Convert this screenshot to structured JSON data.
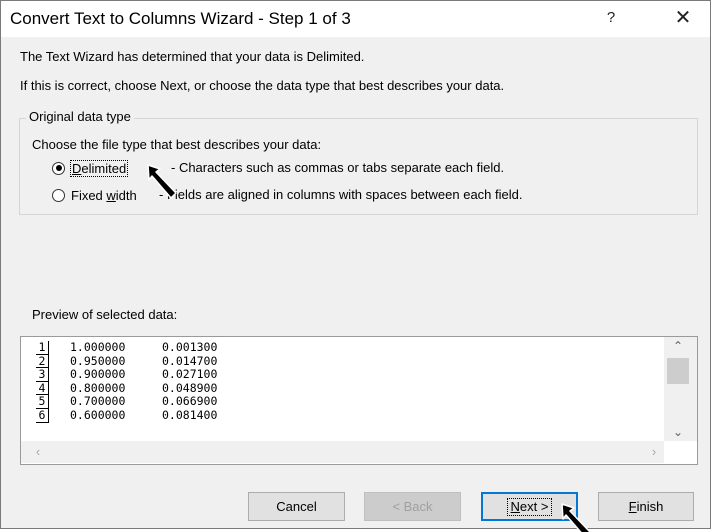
{
  "window": {
    "title": "Convert Text to Columns Wizard - Step 1 of 3",
    "help_label": "?",
    "close_label": "✕"
  },
  "messages": {
    "line1": "The Text Wizard has determined that your data is Delimited.",
    "line2": "If this is correct, choose Next, or choose the data type that best describes your data."
  },
  "group": {
    "legend": "Original data type",
    "prompt": "Choose the file type that best describes your data:",
    "options": [
      {
        "label": "Delimited",
        "mnemonic": "D",
        "rest": "elimited",
        "description": "- Characters such as commas or tabs separate each field.",
        "selected": true
      },
      {
        "label": "Fixed width",
        "pre": "Fixed ",
        "mnemonic": "w",
        "rest": "idth",
        "description": "- Fields are aligned in columns with spaces between each field.",
        "selected": false
      }
    ]
  },
  "preview": {
    "label": "Preview of selected data:",
    "rows": [
      {
        "num": "1",
        "c1": "1.000000",
        "c2": "0.001300"
      },
      {
        "num": "2",
        "c1": "0.950000",
        "c2": "0.014700"
      },
      {
        "num": "3",
        "c1": "0.900000",
        "c2": "0.027100"
      },
      {
        "num": "4",
        "c1": "0.800000",
        "c2": "0.048900"
      },
      {
        "num": "5",
        "c1": "0.700000",
        "c2": "0.066900"
      },
      {
        "num": "6",
        "c1": "0.600000",
        "c2": "0.081400"
      }
    ]
  },
  "buttons": {
    "cancel": "Cancel",
    "back": "< Back",
    "next_mnemonic": "N",
    "next_rest": "ext >",
    "finish_mnemonic": "F",
    "finish_rest": "inish"
  },
  "icons": {
    "scroll_up": "chevron-up-icon",
    "scroll_down": "chevron-down-icon",
    "scroll_left": "chevron-left-icon",
    "scroll_right": "chevron-right-icon",
    "pointer": "arrow-cursor-icon"
  },
  "colors": {
    "accent": "#0078d7",
    "dialog_bg": "#f0f0f0"
  }
}
